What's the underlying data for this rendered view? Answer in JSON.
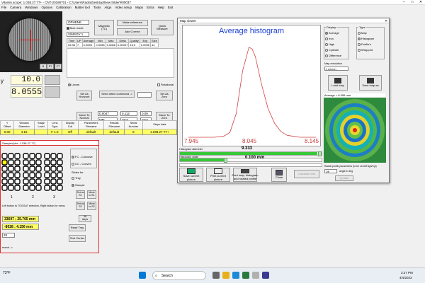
{
  "window": {
    "title": "Vitamin.scope: 1.038.27.77+ - CNT-20190701 - C:\\Users\\Radio\\Desktop\\New folder\\#00037",
    "controls": [
      "–",
      "□",
      "✕"
    ]
  },
  "menu": [
    "File",
    "Camera",
    "Windows",
    "Options",
    "Calibration",
    "Matter tool",
    "Tools",
    "Align",
    "Video setup",
    "Maps",
    "Extra",
    "Help",
    "Exit"
  ],
  "camera": {
    "btn1": "B",
    "btn2": "RT",
    "btn3": "CT"
  },
  "readouts": {
    "y_label": "y",
    "y_value": "10.0",
    "x_value": "8.0555"
  },
  "top_controls": {
    "select1": "OPHENE",
    "check1": "Max mode",
    "select2": "V/MSOV 1",
    "btn_magnetic": "Magnetic\n(TC)",
    "btn_make_ref": "Make reference",
    "btn_add_correct": "Add Correct",
    "btn_quick_measure": "Quick\nMeasure"
  },
  "stats_table": {
    "headers": [
      "Time",
      "UP",
      "Average",
      "Min",
      "Max",
      "Delta",
      "Quality",
      "Exp",
      "Size"
    ],
    "row": [
      "05:36",
      "7",
      "0.0055",
      "0.0055",
      "0.0066",
      "0.00007",
      "16.0",
      "0.0005",
      "44"
    ]
  },
  "command": {
    "linear": "Linear",
    "rotational": "Rotational",
    "btn_set_as_horizontal": "Set As\nHorizont",
    "btn_send_direct": "Send direct command ->",
    "btn_set_as_zero": "Set As\nZero",
    "btn_move_to_normal": "Move To\nNormal",
    "val1": "0.0047",
    "val2": "0.112",
    "val3": "0.09",
    "unit1": "MM",
    "unit2": "Step",
    "unit3": "Step",
    "btn_move_to_zero": "Move To\nZero"
  },
  "param_headers": [
    "Y\nOffset",
    "Window\nDiameter",
    "Stage\nLevel",
    "Lens\nType",
    "Display\nColl",
    "Parameters\nFilename",
    "Results\nFilename",
    "Serial\nNumber",
    "Steps data"
  ],
  "param_values": [
    "0.00",
    "4.16",
    "",
    "F 1.0",
    "Off",
    "default",
    "default",
    "8",
    "1.038.27-77+"
  ],
  "histogram": {
    "window_title": "Map viewer",
    "diameter_label": "Histogram diameter",
    "diameter_value": "9.333",
    "width_label": "Histogram width",
    "width_value": "0.100 mm",
    "btn_save_picture": "Save current picture",
    "btn_print_picture": "Print current picture",
    "btn_print_histogram": "Print map, histogram\nand rotated profile",
    "btn_close": "Close",
    "btn_calculate": "Calculate test",
    "sample_btn": "Sample"
  },
  "chart_data": {
    "type": "line",
    "title": "Average histogram",
    "xlabel": "",
    "ylabel": "",
    "x_ticks": [
      "7.945",
      "8.045",
      "8.145"
    ],
    "xlim": [
      7.945,
      8.145
    ],
    "ylim": [
      0,
      1
    ],
    "grid": false,
    "series": [
      {
        "color": "#d04040",
        "x": [
          7.945,
          7.985,
          8.0,
          8.01,
          8.02,
          8.03,
          8.04,
          8.045,
          8.05,
          8.06,
          8.07,
          8.08,
          8.09,
          8.1,
          8.11,
          8.12,
          8.13,
          8.145
        ],
        "values": [
          0.0,
          0.0,
          0.01,
          0.05,
          0.25,
          0.7,
          0.95,
          0.93,
          0.85,
          0.55,
          0.3,
          0.15,
          0.06,
          0.02,
          0.01,
          0.0,
          0.0,
          0.0
        ]
      }
    ]
  },
  "display_group": {
    "title": "Display",
    "options": [
      "Average",
      "Iron",
      "High",
      "Cylinder",
      "Difference"
    ],
    "selected": 0
  },
  "type_group": {
    "title": "Type",
    "options": [
      "Map",
      "Histogram",
      "Profile's",
      "Wrapped"
    ],
    "selected": 1
  },
  "map_resolution": {
    "label": "Map resolution",
    "value": "1 micron"
  },
  "map_buttons": {
    "load": "Load map",
    "save": "Save map as"
  },
  "map_average": "Average = 8.056 mm",
  "radial_profile": {
    "label": "Radial profile parameters (to be Level/High/Cyl)",
    "value": "Off",
    "unit": "angle in deg",
    "btn_update": "Update"
  },
  "sampler": {
    "title": "Sampler(Ver: 1.038.27-77)",
    "options": [
      "FC - Concave",
      "CC - Convex"
    ],
    "slides_label": "Slides for",
    "slide_options": [
      "Tray",
      "Sample"
    ],
    "col_labels": [
      "1",
      "2",
      "3"
    ],
    "hint": "Left button to TOGGLE selection, Right button for menu",
    "coords1": "33697 ; 25.765 mm",
    "coords2": "-8028 ; 4.156 mm",
    "steps": "38\nsteps",
    "btn_read_tray": "Read Tray",
    "btn_test_center": "Test Center",
    "select_val": "29",
    "btn_set_as_s1": "Set as\nS1",
    "btn_move_s1": "Move\nto S1",
    "btn_set_as_s2": "Set as\nS2",
    "btn_move_s2": "Move\nto S2",
    "footer": "mand ->"
  },
  "taskbar": {
    "weather": "73°F",
    "search_placeholder": "Search",
    "time": "3:27 PM",
    "date": "4/4/2023"
  }
}
